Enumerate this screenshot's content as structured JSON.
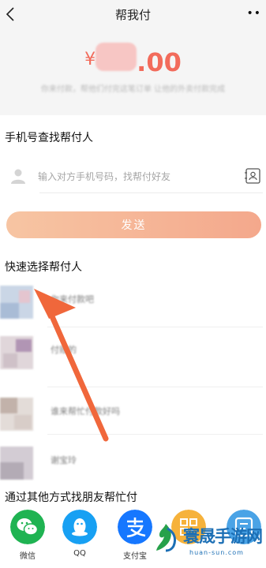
{
  "header": {
    "title": "帮我付",
    "more": "••"
  },
  "order": {
    "currency": "¥",
    "amount_suffix": ".00",
    "subtitle": "你来付款，帮他们付完这笔订单 让他的外卖付款完成"
  },
  "phone_search": {
    "title": "手机号查找帮付人",
    "placeholder": "输入对方手机号码，找帮付好友",
    "send_label": "发送"
  },
  "quick_select": {
    "title": "快速选择帮付人",
    "friends": [
      {
        "name": "你来付款吧",
        "avatar_colors": [
          "#b8c8df",
          "#dfb9c4"
        ]
      },
      {
        "name": "付账的",
        "avatar_colors": [
          "#d9c9cf",
          "#b596b5"
        ]
      },
      {
        "name": "谁来帮忙付款好吗",
        "avatar_colors": [
          "#c8b9b1",
          "#e0d7d3"
        ]
      },
      {
        "name": "谢宝玲",
        "avatar_colors": [
          "#c9c2c9",
          "#b4adb6"
        ]
      }
    ]
  },
  "share": {
    "title": "通过其他方式找朋友帮忙付",
    "items": [
      {
        "label": "微信",
        "icon": "wechat-icon",
        "color": "#1fb352"
      },
      {
        "label": "QQ",
        "icon": "qq-icon",
        "color": "#17a0f3"
      },
      {
        "label": "支付宝",
        "icon": "alipay-icon",
        "color": "#1677ff"
      },
      {
        "label": "",
        "icon": "qrcode-icon",
        "color": "#f6b23b"
      },
      {
        "label": "",
        "icon": "link-icon",
        "color": "#4aa3e6"
      }
    ]
  },
  "watermark": {
    "name": "寰晟手游网",
    "url": "huan-sun.com"
  },
  "colors": {
    "accent": "#f26b5b",
    "arrow": "#f0673b",
    "brand_blue": "#1c6fb5"
  }
}
